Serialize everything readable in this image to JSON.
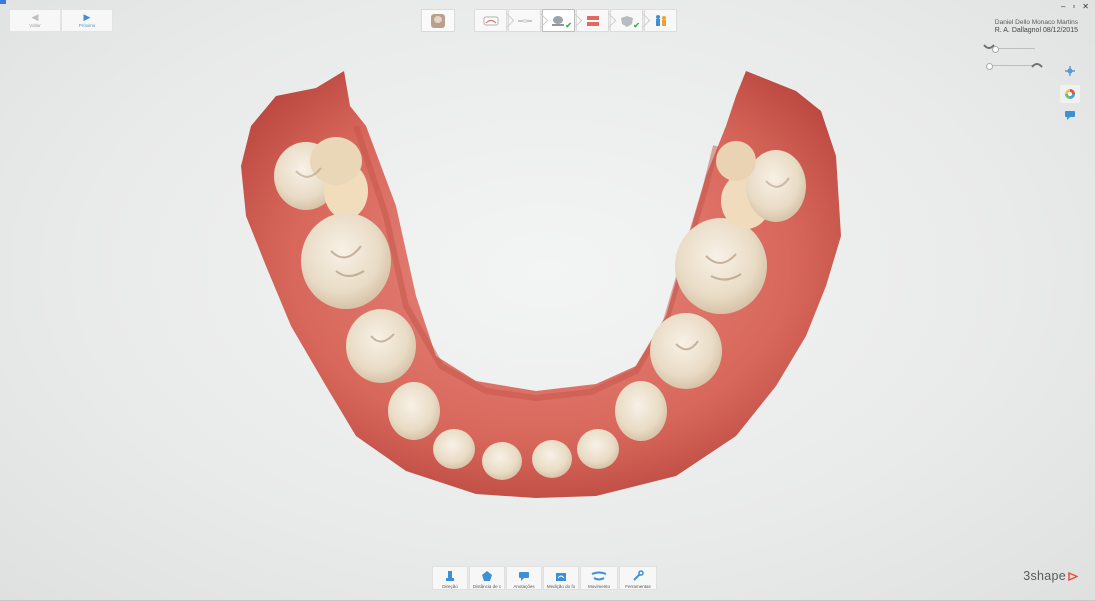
{
  "nav": {
    "prev_label": "Voltar",
    "next_label": "Próximo"
  },
  "user": {
    "name": "Daniel Dello Monaco Martins",
    "subtitle": "R. A. Dallagnol 08/12/2015"
  },
  "workflow": {
    "steps": [
      {
        "icon": "scan-arch-icon",
        "done": false
      },
      {
        "icon": "bite-icon",
        "done": false
      },
      {
        "icon": "post-processing-icon",
        "done": true,
        "active": true
      },
      {
        "icon": "occlusion-icon",
        "done": false
      },
      {
        "icon": "quality-check-icon",
        "done": true
      },
      {
        "icon": "patient-outcome-icon",
        "done": false
      }
    ]
  },
  "tools": [
    {
      "label": "Direção",
      "icon": "direction-icon"
    },
    {
      "label": "Distância de c",
      "icon": "distance-icon"
    },
    {
      "label": "Anotações",
      "icon": "annotations-icon"
    },
    {
      "label": "Medição do fo",
      "icon": "measure-icon"
    },
    {
      "label": "Movimento",
      "icon": "movement-icon"
    },
    {
      "label": "Ferramentas",
      "icon": "tools-icon"
    }
  ],
  "brand": {
    "logo_text": "3shape"
  },
  "colors": {
    "accent": "#3d8fd6",
    "check": "#38b24a",
    "logo_triangle": "#e8503a",
    "gum": "#d96a5e",
    "tooth": "#ece0cc"
  }
}
